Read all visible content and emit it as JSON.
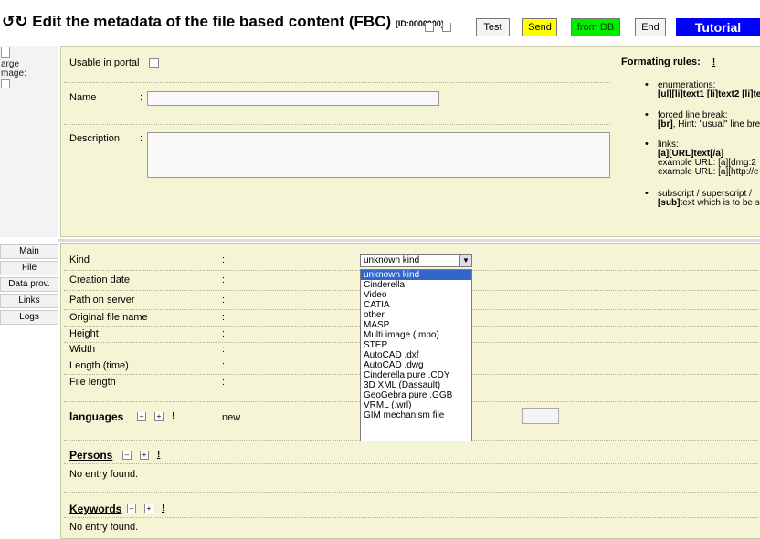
{
  "header": {
    "title": "Edit the metadata of the file based content (FBC)",
    "title_id": "(ID:0000000)",
    "buttons": {
      "test": "Test",
      "send": "Send",
      "from_db": "from DB",
      "end": "End",
      "tutorial": "Tutorial"
    }
  },
  "left_panel": {
    "line1": "arge",
    "line2": "mage:"
  },
  "upper": {
    "usable_in_portal_label": "Usable in portal",
    "name_label": "Name",
    "description_label": "Description",
    "colon": ":",
    "name_value": "",
    "description_value": ""
  },
  "formatting_rules": {
    "title": "Formating rules:",
    "title_excl": "!",
    "items": [
      {
        "line1": "enumerations:",
        "line2": "[ul][li]text1 [li]text2 [li]te"
      },
      {
        "line1": "forced line break:",
        "line2_bold": "[br]",
        "line2_rest": ", Hint: \"usual\" line bre"
      },
      {
        "line1": "links:",
        "line2": "[a][URL]text[/a]",
        "line3": "example URL: [a][dmg:2",
        "line4": "example URL: [a][http://e"
      },
      {
        "line1": "subscript / superscript /",
        "line2_bold": "[sub]",
        "line2_rest": "text which is to be s"
      }
    ]
  },
  "tabs": [
    "Main",
    "File",
    "Data prov.",
    "Links",
    "Logs"
  ],
  "main": {
    "fields": [
      {
        "label": "Kind"
      },
      {
        "label": "Creation date"
      },
      {
        "label": "Path on server"
      },
      {
        "label": "Original file name"
      },
      {
        "label": "Height"
      },
      {
        "label": "Width"
      },
      {
        "label": "Length (time)"
      },
      {
        "label": "File length"
      }
    ],
    "colon": ":",
    "kind_select": {
      "selected": "unknown kind",
      "options": [
        "unknown kind",
        "Cinderella",
        "Video",
        "CATIA",
        "other",
        "MASP",
        "Multi image (.mpo)",
        "STEP",
        "AutoCAD .dxf",
        "AutoCAD .dwg",
        "Cinderella pure .CDY",
        "3D XML (Dassault)",
        "GeoGebra pure .GGB",
        "VRML (.wrl)",
        "GIM mechanism file"
      ]
    },
    "languages": {
      "title": "languages",
      "new_label": "new"
    },
    "persons": {
      "title": "Persons",
      "empty": "No entry found."
    },
    "keywords": {
      "title": "Keywords",
      "empty": "No entry found."
    },
    "mini_buttons": {
      "minus": "–",
      "plus": "+",
      "excl": "!"
    }
  }
}
